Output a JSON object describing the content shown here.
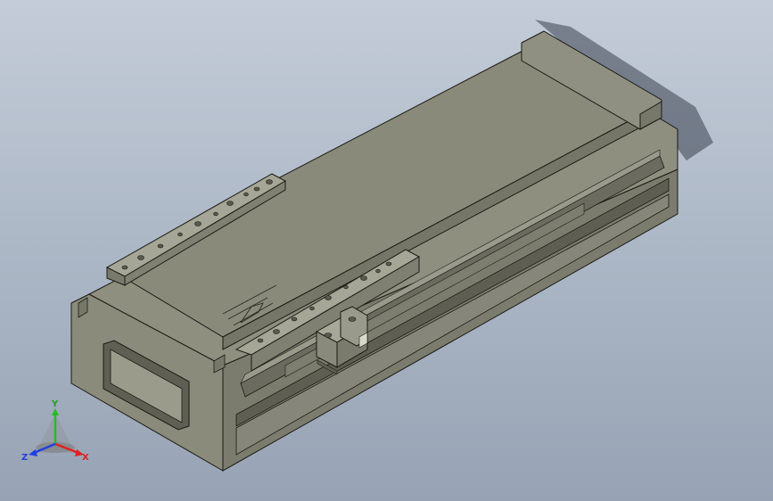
{
  "viewport": {
    "background_top": "#c4ccd8",
    "background_bottom": "#97a3b4"
  },
  "model": {
    "type": "linear-actuator-module",
    "body_color": "#8d8d7e",
    "top_color": "#8a8a7b",
    "side_color": "#7c7c6e",
    "edge_color": "#1a1a14"
  },
  "triad": {
    "x_label": "X",
    "y_label": "Y",
    "z_label": "Z",
    "x_color": "#e02020",
    "y_color": "#20c020",
    "z_color": "#2040e0"
  }
}
